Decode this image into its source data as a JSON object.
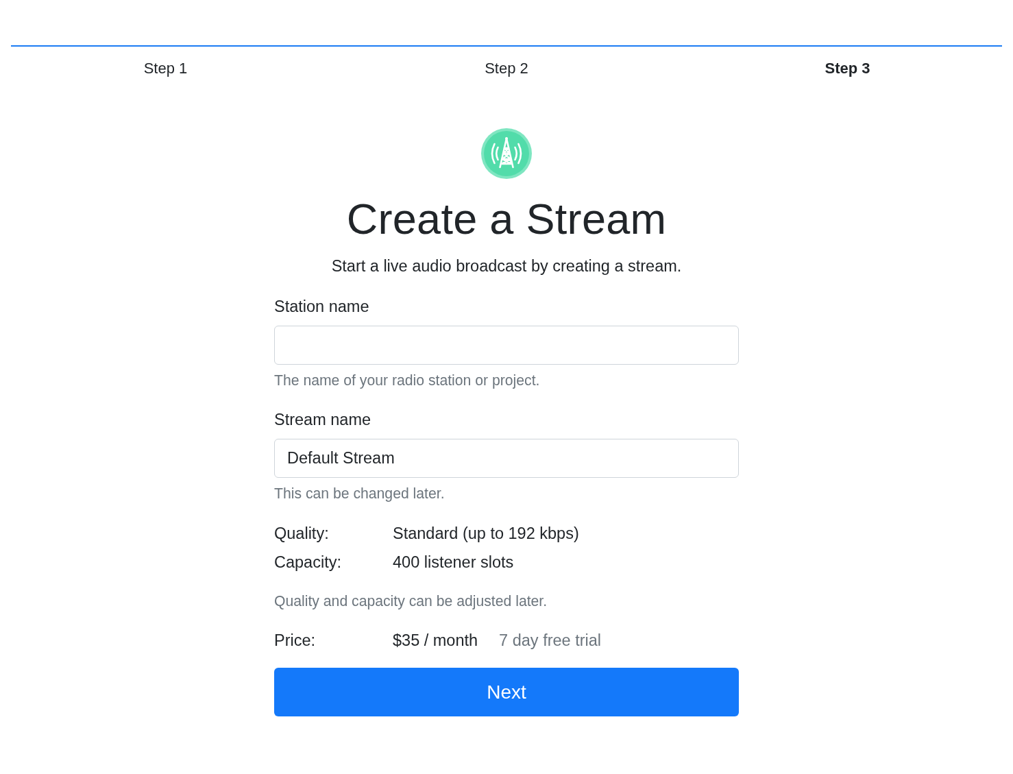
{
  "progress": {
    "level": 1
  },
  "steps": [
    {
      "label": "Step 1",
      "selected": false
    },
    {
      "label": "Step 2",
      "selected": false
    },
    {
      "label": "Step 3",
      "selected": true
    }
  ],
  "header": {
    "title": "Create a Stream",
    "subtitle": "Start a live audio broadcast by creating a stream."
  },
  "form": {
    "fields": [
      {
        "label": "Station name",
        "help": "The name of your radio station or project."
      },
      {
        "label": "Stream name",
        "value": "Default Stream",
        "help": "This can be changed later."
      }
    ],
    "details": [
      {
        "label": "Quality:",
        "value": "Standard (up to 192 kbps)"
      },
      {
        "label": "Capacity:",
        "value": "400 listener slots"
      }
    ],
    "details_note": "Quality and capacity can be adjusted later.",
    "price": {
      "label": "Price:",
      "value": "$35 / month",
      "note": "7 day free trial"
    },
    "button": {
      "label": "Next"
    }
  }
}
